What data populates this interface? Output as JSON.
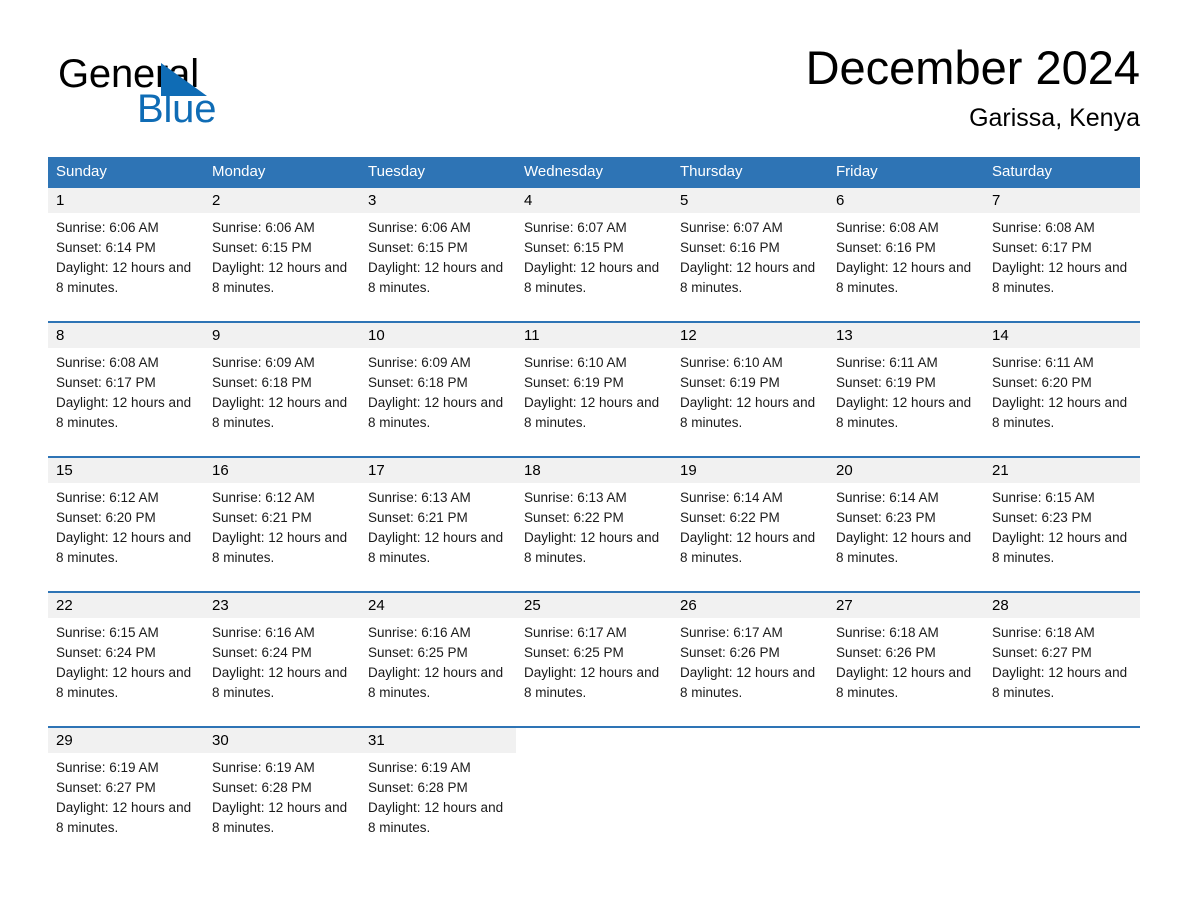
{
  "brand": {
    "line1": "General",
    "line2": "Blue",
    "mark": "triangle-logo",
    "color_dark": "#000000",
    "color_blue": "#0F6CB5"
  },
  "header": {
    "title": "December 2024",
    "subtitle": "Garissa, Kenya"
  },
  "theme": {
    "header_blue": "#2E74B5",
    "daynum_band": "#F1F1F1",
    "text": "#000000"
  },
  "weekdays": [
    "Sunday",
    "Monday",
    "Tuesday",
    "Wednesday",
    "Thursday",
    "Friday",
    "Saturday"
  ],
  "weeks": [
    [
      {
        "day": "1",
        "sunrise": "Sunrise: 6:06 AM",
        "sunset": "Sunset: 6:14 PM",
        "daylight": "Daylight: 12 hours and 8 minutes."
      },
      {
        "day": "2",
        "sunrise": "Sunrise: 6:06 AM",
        "sunset": "Sunset: 6:15 PM",
        "daylight": "Daylight: 12 hours and 8 minutes."
      },
      {
        "day": "3",
        "sunrise": "Sunrise: 6:06 AM",
        "sunset": "Sunset: 6:15 PM",
        "daylight": "Daylight: 12 hours and 8 minutes."
      },
      {
        "day": "4",
        "sunrise": "Sunrise: 6:07 AM",
        "sunset": "Sunset: 6:15 PM",
        "daylight": "Daylight: 12 hours and 8 minutes."
      },
      {
        "day": "5",
        "sunrise": "Sunrise: 6:07 AM",
        "sunset": "Sunset: 6:16 PM",
        "daylight": "Daylight: 12 hours and 8 minutes."
      },
      {
        "day": "6",
        "sunrise": "Sunrise: 6:08 AM",
        "sunset": "Sunset: 6:16 PM",
        "daylight": "Daylight: 12 hours and 8 minutes."
      },
      {
        "day": "7",
        "sunrise": "Sunrise: 6:08 AM",
        "sunset": "Sunset: 6:17 PM",
        "daylight": "Daylight: 12 hours and 8 minutes."
      }
    ],
    [
      {
        "day": "8",
        "sunrise": "Sunrise: 6:08 AM",
        "sunset": "Sunset: 6:17 PM",
        "daylight": "Daylight: 12 hours and 8 minutes."
      },
      {
        "day": "9",
        "sunrise": "Sunrise: 6:09 AM",
        "sunset": "Sunset: 6:18 PM",
        "daylight": "Daylight: 12 hours and 8 minutes."
      },
      {
        "day": "10",
        "sunrise": "Sunrise: 6:09 AM",
        "sunset": "Sunset: 6:18 PM",
        "daylight": "Daylight: 12 hours and 8 minutes."
      },
      {
        "day": "11",
        "sunrise": "Sunrise: 6:10 AM",
        "sunset": "Sunset: 6:19 PM",
        "daylight": "Daylight: 12 hours and 8 minutes."
      },
      {
        "day": "12",
        "sunrise": "Sunrise: 6:10 AM",
        "sunset": "Sunset: 6:19 PM",
        "daylight": "Daylight: 12 hours and 8 minutes."
      },
      {
        "day": "13",
        "sunrise": "Sunrise: 6:11 AM",
        "sunset": "Sunset: 6:19 PM",
        "daylight": "Daylight: 12 hours and 8 minutes."
      },
      {
        "day": "14",
        "sunrise": "Sunrise: 6:11 AM",
        "sunset": "Sunset: 6:20 PM",
        "daylight": "Daylight: 12 hours and 8 minutes."
      }
    ],
    [
      {
        "day": "15",
        "sunrise": "Sunrise: 6:12 AM",
        "sunset": "Sunset: 6:20 PM",
        "daylight": "Daylight: 12 hours and 8 minutes."
      },
      {
        "day": "16",
        "sunrise": "Sunrise: 6:12 AM",
        "sunset": "Sunset: 6:21 PM",
        "daylight": "Daylight: 12 hours and 8 minutes."
      },
      {
        "day": "17",
        "sunrise": "Sunrise: 6:13 AM",
        "sunset": "Sunset: 6:21 PM",
        "daylight": "Daylight: 12 hours and 8 minutes."
      },
      {
        "day": "18",
        "sunrise": "Sunrise: 6:13 AM",
        "sunset": "Sunset: 6:22 PM",
        "daylight": "Daylight: 12 hours and 8 minutes."
      },
      {
        "day": "19",
        "sunrise": "Sunrise: 6:14 AM",
        "sunset": "Sunset: 6:22 PM",
        "daylight": "Daylight: 12 hours and 8 minutes."
      },
      {
        "day": "20",
        "sunrise": "Sunrise: 6:14 AM",
        "sunset": "Sunset: 6:23 PM",
        "daylight": "Daylight: 12 hours and 8 minutes."
      },
      {
        "day": "21",
        "sunrise": "Sunrise: 6:15 AM",
        "sunset": "Sunset: 6:23 PM",
        "daylight": "Daylight: 12 hours and 8 minutes."
      }
    ],
    [
      {
        "day": "22",
        "sunrise": "Sunrise: 6:15 AM",
        "sunset": "Sunset: 6:24 PM",
        "daylight": "Daylight: 12 hours and 8 minutes."
      },
      {
        "day": "23",
        "sunrise": "Sunrise: 6:16 AM",
        "sunset": "Sunset: 6:24 PM",
        "daylight": "Daylight: 12 hours and 8 minutes."
      },
      {
        "day": "24",
        "sunrise": "Sunrise: 6:16 AM",
        "sunset": "Sunset: 6:25 PM",
        "daylight": "Daylight: 12 hours and 8 minutes."
      },
      {
        "day": "25",
        "sunrise": "Sunrise: 6:17 AM",
        "sunset": "Sunset: 6:25 PM",
        "daylight": "Daylight: 12 hours and 8 minutes."
      },
      {
        "day": "26",
        "sunrise": "Sunrise: 6:17 AM",
        "sunset": "Sunset: 6:26 PM",
        "daylight": "Daylight: 12 hours and 8 minutes."
      },
      {
        "day": "27",
        "sunrise": "Sunrise: 6:18 AM",
        "sunset": "Sunset: 6:26 PM",
        "daylight": "Daylight: 12 hours and 8 minutes."
      },
      {
        "day": "28",
        "sunrise": "Sunrise: 6:18 AM",
        "sunset": "Sunset: 6:27 PM",
        "daylight": "Daylight: 12 hours and 8 minutes."
      }
    ],
    [
      {
        "day": "29",
        "sunrise": "Sunrise: 6:19 AM",
        "sunset": "Sunset: 6:27 PM",
        "daylight": "Daylight: 12 hours and 8 minutes."
      },
      {
        "day": "30",
        "sunrise": "Sunrise: 6:19 AM",
        "sunset": "Sunset: 6:28 PM",
        "daylight": "Daylight: 12 hours and 8 minutes."
      },
      {
        "day": "31",
        "sunrise": "Sunrise: 6:19 AM",
        "sunset": "Sunset: 6:28 PM",
        "daylight": "Daylight: 12 hours and 8 minutes."
      },
      {
        "day": "",
        "sunrise": "",
        "sunset": "",
        "daylight": ""
      },
      {
        "day": "",
        "sunrise": "",
        "sunset": "",
        "daylight": ""
      },
      {
        "day": "",
        "sunrise": "",
        "sunset": "",
        "daylight": ""
      },
      {
        "day": "",
        "sunrise": "",
        "sunset": "",
        "daylight": ""
      }
    ]
  ]
}
